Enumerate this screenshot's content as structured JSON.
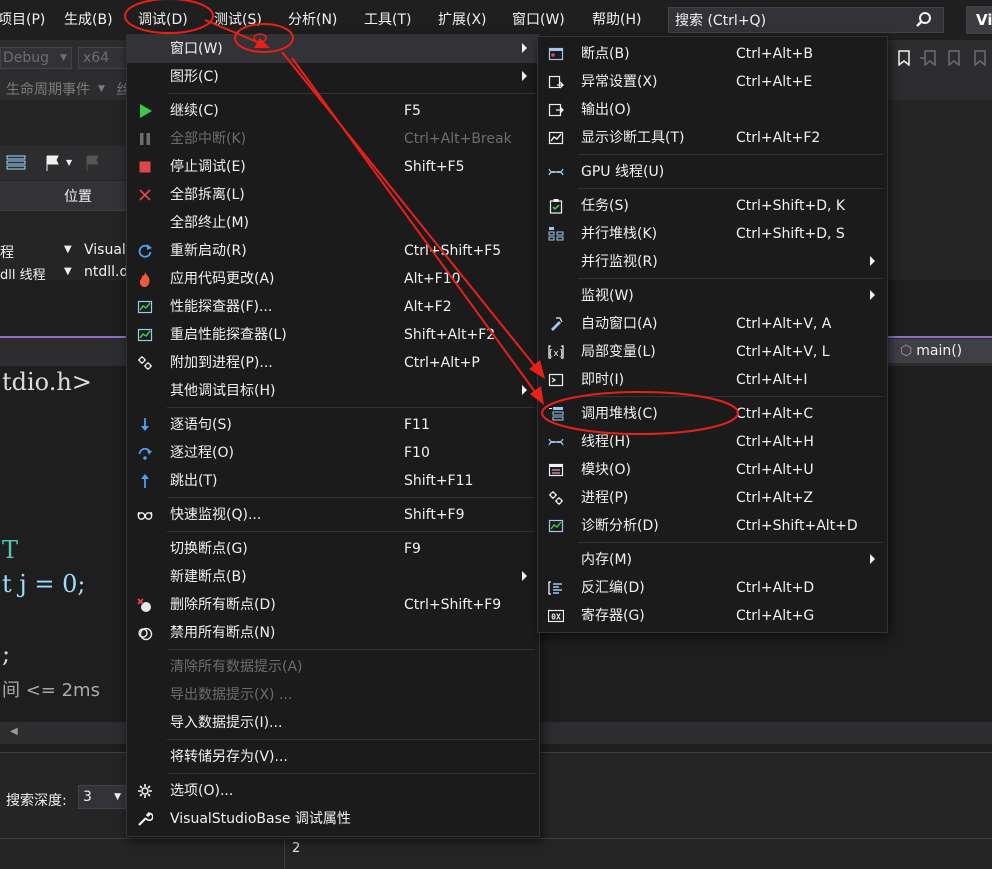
{
  "menubar": {
    "items": [
      "项目(P)",
      "生成(B)",
      "调试(D)",
      "测试(S)",
      "分析(N)",
      "工具(T)",
      "扩展(X)",
      "窗口(W)",
      "帮助(H)"
    ],
    "search": "搜索 (Ctrl+Q)",
    "badge": "Vi"
  },
  "background": {
    "config": "Debug",
    "platform": "x64",
    "lifecycle": "生命周期事件",
    "lifecycle_tail": "丝",
    "location_header": "位置",
    "row1_left": "程",
    "row1_right": "VisualS",
    "row2_left": "dll 线程",
    "row2_right": "ntdll.d",
    "main_tab": "main()",
    "code": [
      "tdio.h>",
      "T",
      "t j = 0;",
      ";",
      "间 <= 2ms"
    ],
    "search_depth_label": "搜索深度:",
    "search_depth_value": "3",
    "row_number": "2"
  },
  "debug_menu": [
    {
      "label": "窗口(W)",
      "shortcut": "",
      "submenu": true,
      "icon": "",
      "highlight": true
    },
    {
      "label": "图形(C)",
      "shortcut": "",
      "submenu": true,
      "icon": ""
    },
    {
      "sep": true
    },
    {
      "label": "继续(C)",
      "shortcut": "F5",
      "icon": "play-icon"
    },
    {
      "label": "全部中断(K)",
      "shortcut": "Ctrl+Alt+Break",
      "icon": "pause-icon",
      "disabled": true
    },
    {
      "label": "停止调试(E)",
      "shortcut": "Shift+F5",
      "icon": "stop-icon"
    },
    {
      "label": "全部拆离(L)",
      "shortcut": "",
      "icon": "detach-icon"
    },
    {
      "label": "全部终止(M)",
      "shortcut": "",
      "icon": ""
    },
    {
      "label": "重新启动(R)",
      "shortcut": "Ctrl+Shift+F5",
      "icon": "restart-icon"
    },
    {
      "label": "应用代码更改(A)",
      "shortcut": "Alt+F10",
      "icon": "hot-reload-icon"
    },
    {
      "label": "性能探查器(F)...",
      "shortcut": "Alt+F2",
      "icon": "profiler-icon"
    },
    {
      "label": "重启性能探查器(L)",
      "shortcut": "Shift+Alt+F2",
      "icon": "profiler-icon"
    },
    {
      "label": "附加到进程(P)...",
      "shortcut": "Ctrl+Alt+P",
      "icon": "attach-icon"
    },
    {
      "label": "其他调试目标(H)",
      "shortcut": "",
      "submenu": true,
      "icon": ""
    },
    {
      "sep": true
    },
    {
      "label": "逐语句(S)",
      "shortcut": "F11",
      "icon": "step-into-icon"
    },
    {
      "label": "逐过程(O)",
      "shortcut": "F10",
      "icon": "step-over-icon"
    },
    {
      "label": "跳出(T)",
      "shortcut": "Shift+F11",
      "icon": "step-out-icon"
    },
    {
      "sep": true
    },
    {
      "label": "快速监视(Q)...",
      "shortcut": "Shift+F9",
      "icon": "glasses-icon"
    },
    {
      "sep": true
    },
    {
      "label": "切换断点(G)",
      "shortcut": "F9",
      "icon": ""
    },
    {
      "label": "新建断点(B)",
      "shortcut": "",
      "submenu": true,
      "icon": ""
    },
    {
      "label": "删除所有断点(D)",
      "shortcut": "Ctrl+Shift+F9",
      "icon": "delete-breakpoints-icon"
    },
    {
      "label": "禁用所有断点(N)",
      "shortcut": "",
      "icon": "disable-breakpoints-icon"
    },
    {
      "sep": true
    },
    {
      "label": "清除所有数据提示(A)",
      "shortcut": "",
      "icon": "",
      "disabled": true
    },
    {
      "label": "导出数据提示(X) ...",
      "shortcut": "",
      "icon": "",
      "disabled": true
    },
    {
      "label": "导入数据提示(I)...",
      "shortcut": "",
      "icon": ""
    },
    {
      "sep": true
    },
    {
      "label": "将转储另存为(V)...",
      "shortcut": "",
      "icon": ""
    },
    {
      "sep": true
    },
    {
      "label": "选项(O)...",
      "shortcut": "",
      "icon": "gear-icon"
    },
    {
      "label": "VisualStudioBase 调试属性",
      "shortcut": "",
      "icon": "wrench-icon"
    }
  ],
  "window_menu": [
    {
      "label": "断点(B)",
      "shortcut": "Ctrl+Alt+B",
      "icon": "breakpoints-window-icon"
    },
    {
      "label": "异常设置(X)",
      "shortcut": "Ctrl+Alt+E",
      "icon": "exception-icon"
    },
    {
      "label": "输出(O)",
      "shortcut": "",
      "icon": "output-icon"
    },
    {
      "label": "显示诊断工具(T)",
      "shortcut": "Ctrl+Alt+F2",
      "icon": "diagnostics-icon"
    },
    {
      "sep": true
    },
    {
      "label": "GPU 线程(U)",
      "shortcut": "",
      "icon": "gpu-threads-icon"
    },
    {
      "sep": true
    },
    {
      "label": "任务(S)",
      "shortcut": "Ctrl+Shift+D, K",
      "icon": "tasks-icon"
    },
    {
      "label": "并行堆栈(K)",
      "shortcut": "Ctrl+Shift+D, S",
      "icon": "parallel-stacks-icon"
    },
    {
      "label": "并行监视(R)",
      "shortcut": "",
      "submenu": true,
      "icon": ""
    },
    {
      "sep": true
    },
    {
      "label": "监视(W)",
      "shortcut": "",
      "submenu": true,
      "icon": ""
    },
    {
      "label": "自动窗口(A)",
      "shortcut": "Ctrl+Alt+V, A",
      "icon": "autos-icon"
    },
    {
      "label": "局部变量(L)",
      "shortcut": "Ctrl+Alt+V, L",
      "icon": "locals-icon"
    },
    {
      "label": "即时(I)",
      "shortcut": "Ctrl+Alt+I",
      "icon": "immediate-icon"
    },
    {
      "sep": true
    },
    {
      "label": "调用堆栈(C)",
      "shortcut": "Ctrl+Alt+C",
      "icon": "call-stack-icon"
    },
    {
      "label": "线程(H)",
      "shortcut": "Ctrl+Alt+H",
      "icon": "threads-icon"
    },
    {
      "label": "模块(O)",
      "shortcut": "Ctrl+Alt+U",
      "icon": "modules-icon"
    },
    {
      "label": "进程(P)",
      "shortcut": "Ctrl+Alt+Z",
      "icon": "processes-icon"
    },
    {
      "label": "诊断分析(D)",
      "shortcut": "Ctrl+Shift+Alt+D",
      "icon": "diag-analysis-icon"
    },
    {
      "sep": true
    },
    {
      "label": "内存(M)",
      "shortcut": "",
      "submenu": true,
      "icon": ""
    },
    {
      "label": "反汇编(D)",
      "shortcut": "Ctrl+Alt+D",
      "icon": "disassembly-icon"
    },
    {
      "label": "寄存器(G)",
      "shortcut": "Ctrl+Alt+G",
      "icon": "registers-icon"
    }
  ],
  "colors": {
    "accent_purple": "#8e6fc6",
    "annotation_red": "#e8201a",
    "menu_bg": "#1b1b1c",
    "highlight": "#333337"
  }
}
